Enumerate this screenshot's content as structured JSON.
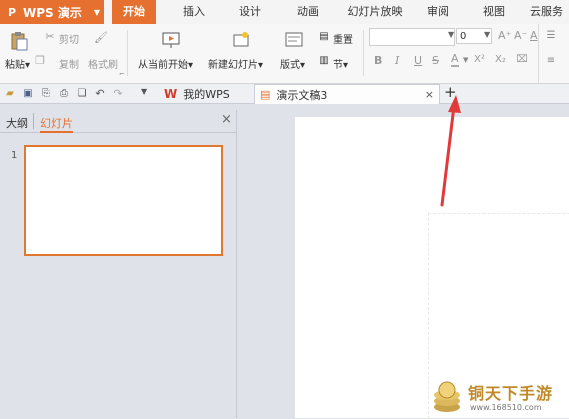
{
  "app": {
    "logo_glyph": "P",
    "name": "WPS 演示"
  },
  "menu_tabs": [
    "开始",
    "插入",
    "设计",
    "动画",
    "幻灯片放映",
    "审阅",
    "视图",
    "云服务"
  ],
  "ribbon": {
    "paste": "粘贴",
    "cut": "剪切",
    "copy": "复制",
    "format_painter": "格式刷",
    "from_current": "从当前开始",
    "new_slide": "新建幻灯片",
    "layout": "版式",
    "reset": "重置",
    "section": "节",
    "font_size": "0",
    "bold": "B",
    "italic": "I",
    "underline": "U",
    "strike": "S",
    "font_color": "A",
    "superscript": "X²",
    "subscript": "X₂",
    "grow": "A⁺",
    "shrink": "A⁻",
    "clear": "A"
  },
  "doc_tabs": {
    "home_label": "我的WPS",
    "doc_label": "演示文稿3",
    "close_glyph": "×",
    "add_glyph": "+"
  },
  "left_panel": {
    "tab_outline": "大纲",
    "tab_slides": "幻灯片",
    "close_glyph": "×",
    "slide_number": "1"
  },
  "watermark": {
    "title": "铜天下手游",
    "url": "www.168510.com"
  },
  "colors": {
    "accent": "#e6702f",
    "arrow": "#e03a3a",
    "panel_bg": "#dfe3e9"
  }
}
